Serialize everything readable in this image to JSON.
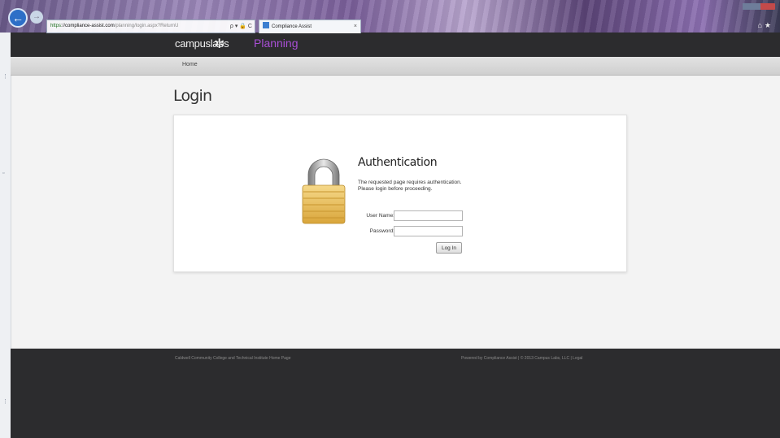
{
  "browser": {
    "address": {
      "scheme": "https",
      "host": "compliance-assist.com",
      "path": "/planning/login.aspx?ReturnU",
      "controls": "ρ ▾ 🔒 C"
    },
    "tab": {
      "title": "Compliance Assist",
      "close": "×"
    }
  },
  "header": {
    "brand": "campuslabs",
    "product": "Planning"
  },
  "nav": {
    "home": "Home"
  },
  "page": {
    "title": "Login"
  },
  "auth": {
    "title": "Authentication",
    "message_line1": "The requested page requires authentication.",
    "message_line2": "Please login before proceeding.",
    "username_label": "User Name:",
    "username_value": "",
    "password_label": "Password:",
    "password_value": "",
    "submit_label": "Log In"
  },
  "footer": {
    "left": "Caldwell Community College and Technical Institute Home Page",
    "right": "Powered by Compliance Assist | © 2013 Campus Labs, LLC | Legal"
  },
  "colors": {
    "header_bg": "#2c2c2e",
    "product_accent": "#a94fd6",
    "footer_bg": "#2c2c2e"
  },
  "icons": [
    "back-arrow-icon",
    "forward-arrow-icon",
    "campuslabs-logo-icon",
    "padlock-icon",
    "tab-favicon-icon"
  ]
}
